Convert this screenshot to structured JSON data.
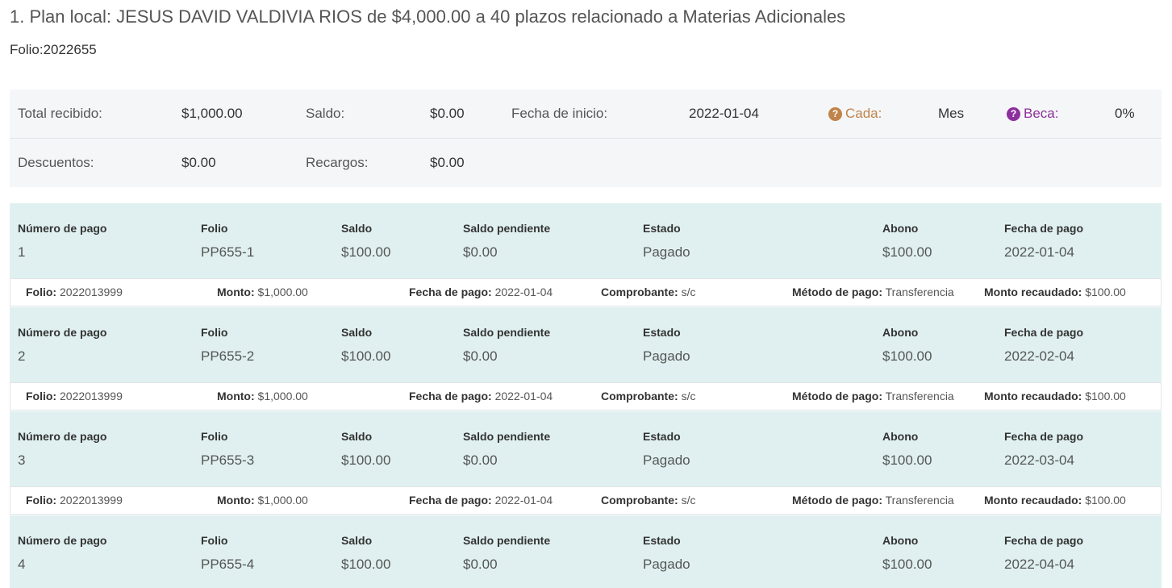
{
  "header": {
    "title": "1. Plan local: JESUS DAVID VALDIVIA RIOS de $4,000.00 a 40 plazos relacionado a Materias Adicionales",
    "folio": "Folio:2022655"
  },
  "summary": {
    "total_recibido_label": "Total recibido:",
    "total_recibido_value": "$1,000.00",
    "saldo_label": "Saldo:",
    "saldo_value": "$0.00",
    "fecha_inicio_label": "Fecha de inicio:",
    "fecha_inicio_value": "2022-01-04",
    "cada_icon": "?",
    "cada_label": "Cada:",
    "cada_value": "Mes",
    "beca_icon": "?",
    "beca_label": "Beca:",
    "beca_value": "0%",
    "descuentos_label": "Descuentos:",
    "descuentos_value": "$0.00",
    "recargos_label": "Recargos:",
    "recargos_value": "$0.00"
  },
  "payment_headers": {
    "numero": "Número de pago",
    "folio": "Folio",
    "saldo": "Saldo",
    "saldo_pendiente": "Saldo pendiente",
    "estado": "Estado",
    "abono": "Abono",
    "fecha_pago": "Fecha de pago"
  },
  "payments": [
    {
      "numero": "1",
      "folio": "PP655-1",
      "saldo": "$100.00",
      "saldo_pendiente": "$0.00",
      "estado": "Pagado",
      "abono": "$100.00",
      "fecha_pago": "2022-01-04"
    },
    {
      "numero": "2",
      "folio": "PP655-2",
      "saldo": "$100.00",
      "saldo_pendiente": "$0.00",
      "estado": "Pagado",
      "abono": "$100.00",
      "fecha_pago": "2022-02-04"
    },
    {
      "numero": "3",
      "folio": "PP655-3",
      "saldo": "$100.00",
      "saldo_pendiente": "$0.00",
      "estado": "Pagado",
      "abono": "$100.00",
      "fecha_pago": "2022-03-04"
    },
    {
      "numero": "4",
      "folio": "PP655-4",
      "saldo": "$100.00",
      "saldo_pendiente": "$0.00",
      "estado": "Pagado",
      "abono": "$100.00",
      "fecha_pago": "2022-04-04"
    }
  ],
  "detail_labels": {
    "folio": "Folio:",
    "monto": "Monto:",
    "fecha_pago": "Fecha de pago:",
    "comprobante": "Comprobante:",
    "metodo_pago": "Método de pago:",
    "monto_recaudado": "Monto recaudado:"
  },
  "details": [
    {
      "folio": "2022013999",
      "monto": "$1,000.00",
      "fecha_pago": "2022-01-04",
      "comprobante": "s/c",
      "metodo_pago": "Transferencia",
      "monto_recaudado": "$100.00"
    },
    {
      "folio": "2022013999",
      "monto": "$1,000.00",
      "fecha_pago": "2022-01-04",
      "comprobante": "s/c",
      "metodo_pago": "Transferencia",
      "monto_recaudado": "$100.00"
    },
    {
      "folio": "2022013999",
      "monto": "$1,000.00",
      "fecha_pago": "2022-01-04",
      "comprobante": "s/c",
      "metodo_pago": "Transferencia",
      "monto_recaudado": "$100.00"
    }
  ],
  "colors": {
    "payment_bg": "#e0f0f0",
    "summary_bg": "#f5f6f8",
    "cada_accent": "#c0834a",
    "beca_accent": "#8e2f9e"
  }
}
